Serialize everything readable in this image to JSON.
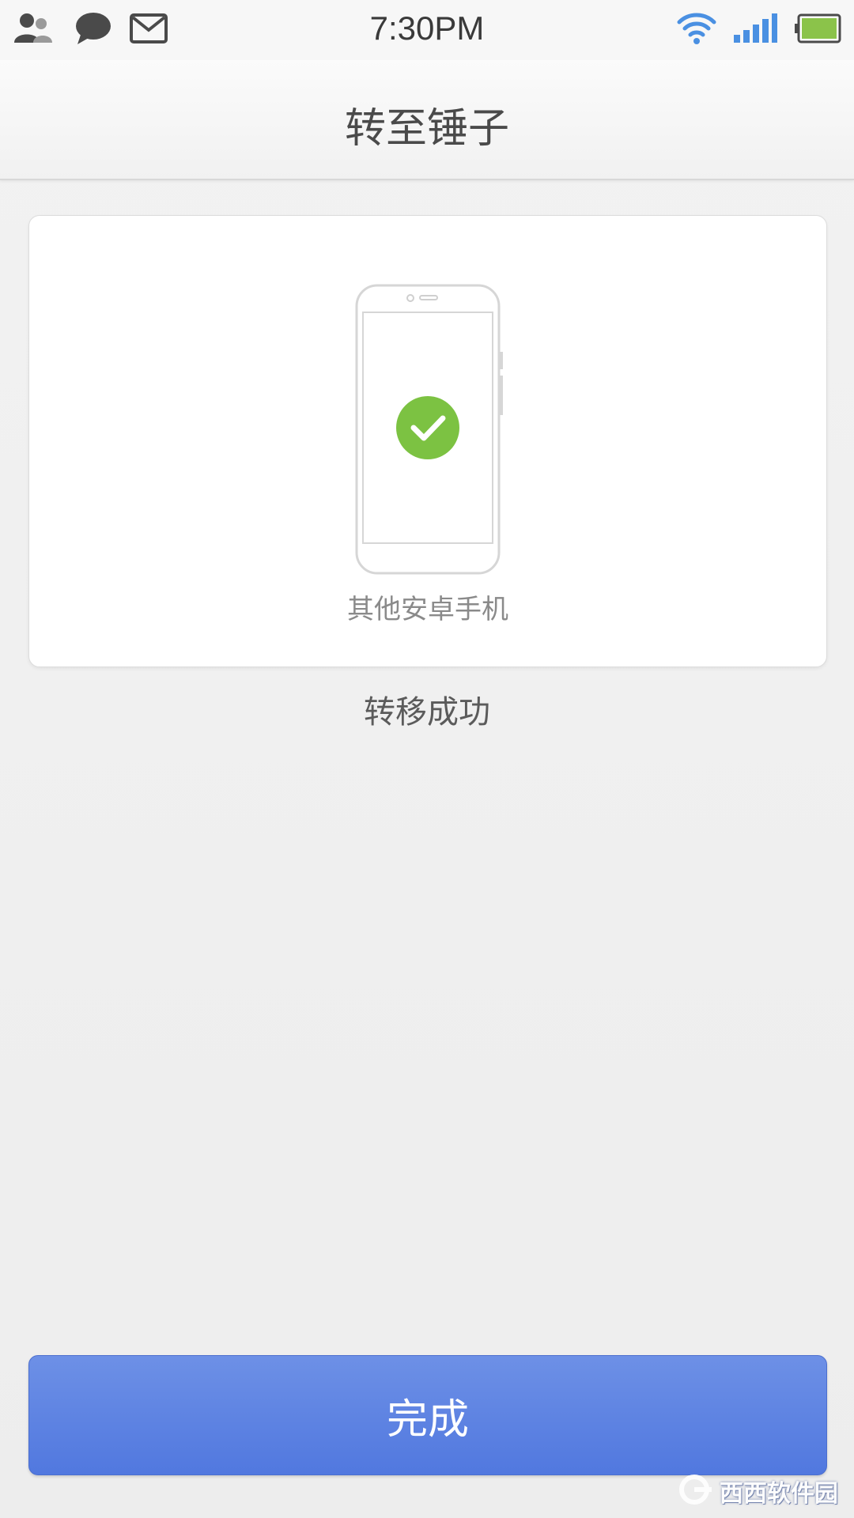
{
  "status_bar": {
    "time": "7:30PM",
    "left_icons": [
      "contacts-icon",
      "chat-bubble-icon",
      "mail-icon"
    ],
    "right_icons": [
      "wifi-icon",
      "signal-icon",
      "battery-icon"
    ],
    "accent_wifi": "#4a90e2",
    "battery_color": "#8bc34a"
  },
  "title_bar": {
    "title": "转至锤子"
  },
  "card": {
    "device_label": "其他安卓手机",
    "check_color": "#7cc242"
  },
  "status_message": "转移成功",
  "done_button": {
    "label": "完成",
    "color": "#5a80e2"
  },
  "watermark": {
    "text": "西西软件园"
  }
}
